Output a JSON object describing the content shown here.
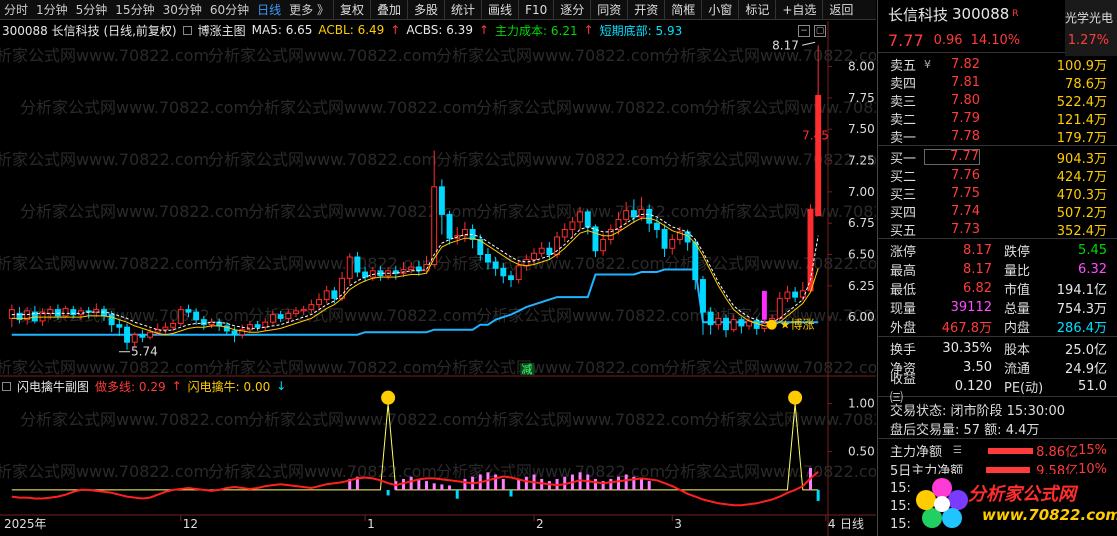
{
  "toolbar": {
    "periods": [
      "分时",
      "1分钟",
      "5分钟",
      "15分钟",
      "30分钟",
      "60分钟",
      "日线",
      "更多 》"
    ],
    "active_period": "日线",
    "buttons": [
      "复权",
      "叠加",
      "多股",
      "统计",
      "画线",
      "F10",
      "逐分",
      "同资",
      "开资",
      "简框",
      "小窗",
      "标记",
      "+自选",
      "返回"
    ]
  },
  "main_legend": {
    "stock": "300088 长信科技 (日线,前复权)",
    "formula": "博涨主图",
    "ma5": "MA5: 6.65",
    "acbl": "ACBL: 6.49",
    "acbs": "ACBS: 6.39",
    "cost": "主力成本: 6.21",
    "bottom": "短期底部: 5.93"
  },
  "sub_legend": {
    "name": "闪电擒牛副图",
    "line1": "做多线: 0.29",
    "line2": "闪电擒牛: 0.00"
  },
  "y_axis_main": [
    "8.00",
    "7.75",
    "7.50",
    "7.25",
    "7.00",
    "6.75",
    "6.50",
    "6.25",
    "6.00"
  ],
  "y_axis_sub": [
    "1.00",
    "0.50"
  ],
  "x_axis": [
    "2025年",
    "12",
    "1",
    "2",
    "3",
    "4"
  ],
  "period_label": "日线",
  "annotations": {
    "high": "8.17",
    "low": "5.74",
    "mid": "7.45",
    "signal": "★博涨",
    "flag": "减"
  },
  "watermark": "分析家公式网www.70822.com",
  "chart_data": {
    "type": "candlestick",
    "ylim": [
      5.65,
      8.22
    ],
    "candles": [
      [
        5.99,
        6.06,
        6.1,
        5.92
      ],
      [
        6.03,
        5.98,
        6.08,
        5.95
      ],
      [
        5.98,
        6.05,
        6.08,
        5.94
      ],
      [
        6.04,
        5.97,
        6.09,
        5.95
      ],
      [
        5.97,
        6.04,
        6.07,
        5.93
      ],
      [
        6.03,
        6.06,
        6.09,
        5.98
      ],
      [
        6.06,
        6.01,
        6.1,
        5.98
      ],
      [
        6.01,
        6.07,
        6.09,
        5.99
      ],
      [
        6.06,
        6.02,
        6.09,
        5.99
      ],
      [
        6.02,
        6.05,
        6.08,
        5.98
      ],
      [
        6.05,
        6.04,
        6.08,
        5.99
      ],
      [
        6.04,
        6.06,
        6.11,
        6.0
      ],
      [
        6.06,
        6.01,
        6.09,
        5.97
      ],
      [
        6.02,
        5.94,
        6.05,
        5.88
      ],
      [
        5.94,
        5.92,
        5.98,
        5.85
      ],
      [
        5.92,
        5.8,
        5.95,
        5.74
      ],
      [
        5.8,
        5.86,
        5.88,
        5.76
      ],
      [
        5.86,
        5.84,
        5.9,
        5.8
      ],
      [
        5.84,
        5.88,
        5.91,
        5.82
      ],
      [
        5.88,
        5.9,
        5.95,
        5.85
      ],
      [
        5.9,
        5.92,
        5.96,
        5.86
      ],
      [
        5.92,
        5.95,
        5.98,
        5.89
      ],
      [
        5.95,
        6.06,
        6.09,
        5.93
      ],
      [
        6.06,
        6.04,
        6.1,
        6.0
      ],
      [
        6.04,
        5.98,
        6.07,
        5.94
      ],
      [
        5.98,
        5.94,
        6.01,
        5.9
      ],
      [
        5.94,
        5.96,
        5.99,
        5.91
      ],
      [
        5.96,
        5.93,
        5.99,
        5.89
      ],
      [
        5.93,
        5.89,
        5.96,
        5.86
      ],
      [
        5.89,
        5.86,
        5.92,
        5.8
      ],
      [
        5.86,
        5.9,
        5.94,
        5.83
      ],
      [
        5.9,
        5.94,
        5.97,
        5.88
      ],
      [
        5.94,
        5.92,
        5.97,
        5.89
      ],
      [
        5.92,
        5.96,
        5.99,
        5.89
      ],
      [
        5.96,
        6.02,
        6.05,
        5.94
      ],
      [
        6.02,
        5.99,
        6.05,
        5.96
      ],
      [
        5.99,
        6.03,
        6.06,
        5.96
      ],
      [
        6.03,
        6.05,
        6.08,
        6.0
      ],
      [
        6.05,
        6.06,
        6.09,
        6.02
      ],
      [
        6.06,
        6.1,
        6.14,
        6.03
      ],
      [
        6.1,
        6.14,
        6.19,
        6.07
      ],
      [
        6.14,
        6.21,
        6.25,
        6.11
      ],
      [
        6.21,
        6.15,
        6.24,
        6.11
      ],
      [
        6.15,
        6.31,
        6.36,
        6.13
      ],
      [
        6.31,
        6.48,
        6.51,
        6.26
      ],
      [
        6.48,
        6.36,
        6.52,
        6.32
      ],
      [
        6.36,
        6.32,
        6.4,
        6.28
      ],
      [
        6.32,
        6.37,
        6.4,
        6.29
      ],
      [
        6.37,
        6.33,
        6.41,
        6.29
      ],
      [
        6.33,
        6.37,
        6.4,
        6.3
      ],
      [
        6.37,
        6.35,
        6.41,
        6.3
      ],
      [
        6.35,
        6.38,
        6.44,
        6.32
      ],
      [
        6.38,
        6.4,
        6.44,
        6.35
      ],
      [
        6.4,
        6.37,
        6.45,
        6.33
      ],
      [
        6.37,
        6.42,
        6.49,
        6.35
      ],
      [
        6.42,
        7.04,
        7.33,
        6.4
      ],
      [
        7.04,
        6.82,
        7.1,
        6.66
      ],
      [
        6.82,
        6.63,
        6.85,
        6.58
      ],
      [
        6.63,
        6.65,
        6.72,
        6.58
      ],
      [
        6.65,
        6.7,
        6.76,
        6.6
      ],
      [
        6.7,
        6.62,
        6.74,
        6.55
      ],
      [
        6.62,
        6.5,
        6.66,
        6.45
      ],
      [
        6.5,
        6.44,
        6.55,
        6.38
      ],
      [
        6.44,
        6.39,
        6.48,
        6.33
      ],
      [
        6.39,
        6.33,
        6.43,
        6.27
      ],
      [
        6.33,
        6.3,
        6.37,
        6.24
      ],
      [
        6.3,
        6.41,
        6.45,
        6.27
      ],
      [
        6.41,
        6.46,
        6.5,
        6.37
      ],
      [
        6.46,
        6.51,
        6.55,
        6.42
      ],
      [
        6.51,
        6.55,
        6.6,
        6.48
      ],
      [
        6.55,
        6.5,
        6.6,
        6.46
      ],
      [
        6.5,
        6.64,
        6.68,
        6.47
      ],
      [
        6.64,
        6.7,
        6.75,
        6.6
      ],
      [
        6.7,
        6.76,
        6.8,
        6.64
      ],
      [
        6.76,
        6.84,
        6.88,
        6.7
      ],
      [
        6.84,
        6.72,
        6.86,
        6.66
      ],
      [
        6.72,
        6.53,
        6.74,
        6.48
      ],
      [
        6.53,
        6.62,
        6.67,
        6.49
      ],
      [
        6.62,
        6.7,
        6.74,
        6.58
      ],
      [
        6.7,
        6.78,
        6.84,
        6.66
      ],
      [
        6.78,
        6.85,
        6.92,
        6.74
      ],
      [
        6.85,
        6.8,
        6.94,
        6.75
      ],
      [
        6.8,
        6.86,
        6.96,
        6.77
      ],
      [
        6.86,
        6.75,
        6.9,
        6.68
      ],
      [
        6.75,
        6.7,
        6.79,
        6.63
      ],
      [
        6.7,
        6.55,
        6.74,
        6.48
      ],
      [
        6.55,
        6.62,
        6.66,
        6.5
      ],
      [
        6.62,
        6.68,
        6.72,
        6.58
      ],
      [
        6.68,
        6.6,
        6.7,
        6.53
      ],
      [
        6.6,
        6.3,
        6.62,
        6.22
      ],
      [
        6.3,
        6.04,
        6.33,
        5.86
      ],
      [
        6.04,
        5.94,
        6.08,
        5.86
      ],
      [
        5.94,
        5.99,
        6.04,
        5.9
      ],
      [
        5.99,
        5.9,
        6.02,
        5.84
      ],
      [
        5.9,
        5.98,
        6.02,
        5.88
      ],
      [
        5.98,
        5.93,
        6.0,
        5.87
      ],
      [
        5.93,
        5.97,
        6.0,
        5.9
      ],
      [
        5.97,
        5.91,
        6.0,
        5.86
      ],
      [
        5.91,
        5.95,
        5.98,
        5.88
      ],
      [
        5.95,
        5.99,
        6.02,
        5.92
      ],
      [
        5.99,
        6.15,
        6.2,
        5.97
      ],
      [
        6.15,
        6.2,
        6.25,
        6.12
      ],
      [
        6.2,
        6.16,
        6.24,
        6.12
      ],
      [
        6.16,
        6.21,
        6.28,
        6.13
      ],
      [
        6.21,
        6.86,
        6.9,
        6.75
      ],
      [
        6.81,
        7.77,
        8.17,
        6.82
      ]
    ],
    "ma_line": [
      6.02,
      6.02,
      6.02,
      6.03,
      6.03,
      6.03,
      6.03,
      6.03,
      6.03,
      6.03,
      6.04,
      6.04,
      6.04,
      6.03,
      6.01,
      5.99,
      5.96,
      5.94,
      5.92,
      5.9,
      5.89,
      5.9,
      5.92,
      5.94,
      5.95,
      5.95,
      5.96,
      5.96,
      5.95,
      5.93,
      5.92,
      5.91,
      5.91,
      5.92,
      5.93,
      5.94,
      5.96,
      5.98,
      6.0,
      6.02,
      6.06,
      6.1,
      6.13,
      6.18,
      6.25,
      6.29,
      6.32,
      6.34,
      6.35,
      6.35,
      6.35,
      6.36,
      6.37,
      6.37,
      6.38,
      6.5,
      6.59,
      6.62,
      6.64,
      6.66,
      6.66,
      6.64,
      6.6,
      6.56,
      6.52,
      6.48,
      6.45,
      6.44,
      6.45,
      6.47,
      6.49,
      6.53,
      6.58,
      6.64,
      6.7,
      6.72,
      6.7,
      6.68,
      6.68,
      6.71,
      6.75,
      6.79,
      6.82,
      6.82,
      6.8,
      6.76,
      6.72,
      6.7,
      6.68,
      6.62,
      6.52,
      6.4,
      6.28,
      6.18,
      6.09,
      6.04,
      6.0,
      5.98,
      5.96,
      5.96,
      5.99,
      6.04,
      6.09,
      6.14,
      6.3,
      6.65
    ],
    "ma_line2": [
      5.99,
      5.99,
      5.99,
      6.0,
      6.0,
      6.0,
      6.0,
      6.0,
      6.0,
      6.0,
      6.01,
      6.01,
      6.01,
      6.0,
      5.98,
      5.96,
      5.93,
      5.91,
      5.89,
      5.87,
      5.86,
      5.87,
      5.89,
      5.91,
      5.92,
      5.92,
      5.93,
      5.93,
      5.92,
      5.9,
      5.89,
      5.88,
      5.88,
      5.89,
      5.9,
      5.91,
      5.93,
      5.95,
      5.97,
      5.99,
      6.03,
      6.07,
      6.1,
      6.15,
      6.22,
      6.26,
      6.29,
      6.31,
      6.32,
      6.32,
      6.32,
      6.33,
      6.34,
      6.34,
      6.35,
      6.47,
      6.56,
      6.59,
      6.61,
      6.63,
      6.63,
      6.61,
      6.57,
      6.53,
      6.49,
      6.45,
      6.42,
      6.41,
      6.42,
      6.44,
      6.46,
      6.5,
      6.55,
      6.61,
      6.67,
      6.69,
      6.67,
      6.65,
      6.65,
      6.68,
      6.72,
      6.76,
      6.79,
      6.79,
      6.77,
      6.73,
      6.69,
      6.67,
      6.65,
      6.59,
      6.49,
      6.37,
      6.25,
      6.15,
      6.06,
      6.01,
      5.97,
      5.95,
      5.93,
      5.93,
      5.96,
      6.01,
      6.06,
      6.11,
      6.2,
      6.39
    ],
    "cost_line": [
      5.86,
      5.86,
      5.86,
      5.86,
      5.86,
      5.86,
      5.86,
      5.86,
      5.86,
      5.86,
      5.86,
      5.86,
      5.86,
      5.86,
      5.86,
      5.86,
      5.86,
      5.86,
      5.86,
      5.86,
      5.86,
      5.86,
      5.86,
      5.86,
      5.86,
      5.86,
      5.86,
      5.86,
      5.86,
      5.86,
      5.86,
      5.86,
      5.86,
      5.86,
      5.86,
      5.86,
      5.86,
      5.86,
      5.86,
      5.86,
      5.86,
      5.86,
      5.86,
      5.86,
      5.86,
      5.86,
      5.88,
      5.88,
      5.88,
      5.88,
      5.88,
      5.88,
      5.88,
      5.88,
      5.88,
      5.9,
      5.9,
      5.9,
      5.9,
      5.9,
      5.9,
      5.94,
      5.94,
      5.98,
      6.0,
      6.02,
      6.05,
      6.08,
      6.1,
      6.12,
      6.14,
      6.16,
      6.16,
      6.16,
      6.16,
      6.16,
      6.34,
      6.34,
      6.34,
      6.34,
      6.34,
      6.34,
      6.36,
      6.36,
      6.36,
      6.38,
      6.38,
      6.38,
      6.38,
      6.38,
      5.96,
      5.96,
      5.96,
      5.96,
      5.96,
      5.96,
      5.96,
      5.96,
      5.96,
      5.96,
      5.96,
      5.96,
      5.96,
      5.96,
      5.96,
      5.96
    ],
    "sub_line": [
      0.03,
      0.02,
      0.02,
      0.01,
      0.01,
      0.02,
      0.03,
      0.05,
      0.08,
      0.1,
      0.1,
      0.09,
      0.08,
      0.07,
      0.05,
      0.03,
      0.02,
      0.01,
      0.02,
      0.05,
      0.08,
      0.1,
      0.11,
      0.12,
      0.11,
      0.1,
      0.09,
      0.1,
      0.12,
      0.13,
      0.12,
      0.11,
      0.12,
      0.14,
      0.15,
      0.16,
      0.15,
      0.14,
      0.13,
      0.12,
      0.14,
      0.16,
      0.17,
      0.18,
      0.2,
      0.22,
      0.23,
      0.22,
      0.2,
      0.17,
      0.15,
      0.17,
      0.19,
      0.21,
      0.22,
      0.22,
      0.21,
      0.2,
      0.19,
      0.18,
      0.17,
      0.18,
      0.2,
      0.22,
      0.24,
      0.23,
      0.21,
      0.19,
      0.18,
      0.17,
      0.16,
      0.15,
      0.16,
      0.18,
      0.2,
      0.19,
      0.18,
      0.17,
      0.18,
      0.19,
      0.2,
      0.21,
      0.22,
      0.21,
      0.2,
      0.17,
      0.14,
      0.1,
      0.06,
      0.03,
      0.0,
      -0.02,
      -0.04,
      -0.05,
      -0.06,
      -0.06,
      -0.05,
      -0.04,
      -0.02,
      0.0,
      0.03,
      0.07,
      0.1,
      0.14,
      0.22,
      0.29
    ],
    "sub_yellow": [
      0.1,
      0.1,
      0.1,
      0.1,
      0.1,
      0.1,
      0.1,
      0.1,
      0.1,
      0.1,
      0.1,
      0.1,
      0.1,
      0.1,
      0.1,
      0.1,
      0.1,
      0.1,
      0.1,
      0.1,
      0.1,
      0.1,
      0.1,
      0.1,
      0.1,
      0.1,
      0.1,
      0.1,
      0.1,
      0.1,
      0.1,
      0.1,
      0.1,
      0.1,
      0.1,
      0.1,
      0.1,
      0.1,
      0.1,
      0.1,
      0.1,
      0.1,
      0.1,
      0.1,
      0.1,
      0.1,
      0.1,
      0.1,
      0.1,
      1.0,
      0.1,
      0.1,
      0.1,
      0.1,
      0.1,
      0.1,
      0.1,
      0.1,
      0.1,
      0.1,
      0.1,
      0.1,
      0.1,
      0.1,
      0.1,
      0.1,
      0.1,
      0.1,
      0.1,
      0.1,
      0.1,
      0.1,
      0.1,
      0.1,
      0.1,
      0.1,
      0.1,
      0.1,
      0.1,
      0.1,
      0.1,
      0.1,
      0.1,
      0.1,
      0.1,
      0.1,
      0.1,
      0.1,
      0.1,
      0.1,
      0.1,
      0.1,
      0.1,
      0.1,
      0.1,
      0.1,
      0.1,
      0.1,
      0.1,
      0.1,
      0.1,
      0.1,
      1.0,
      0.1,
      0.1,
      0.1
    ],
    "sub_bars": [
      0,
      0,
      0,
      0,
      0,
      0,
      0,
      0,
      0,
      0,
      0,
      0,
      0,
      0,
      0,
      0,
      0,
      0,
      0,
      0,
      0,
      0,
      0,
      0,
      0,
      0,
      0,
      0,
      0,
      0,
      0,
      0,
      0,
      0,
      0,
      0,
      0,
      0,
      0,
      0,
      0,
      0,
      0,
      0,
      0.1,
      0.12,
      0,
      0,
      0,
      -0.05,
      0.08,
      0.1,
      0.12,
      0.1,
      0.08,
      0.06,
      0.05,
      0.04,
      -0.08,
      0.1,
      0.12,
      0.14,
      0.16,
      0.14,
      0.1,
      -0.06,
      0.1,
      0.12,
      0.14,
      0.1,
      0.08,
      0.1,
      0.12,
      0.14,
      0.16,
      0.14,
      0.1,
      0.08,
      0.1,
      0.12,
      0.14,
      0.12,
      0.1,
      0.08,
      0,
      0,
      0,
      0,
      0,
      0,
      0,
      0,
      0,
      0,
      0,
      0,
      0,
      0,
      0,
      0,
      0,
      0,
      0,
      0,
      0.2,
      -0.1
    ]
  },
  "quote": {
    "name": "长信科技",
    "code": "300088",
    "badge": "R",
    "sector": "光学光电",
    "price": "7.77",
    "change": "0.96",
    "pct": "14.10%",
    "sector_pct": "1.27%",
    "asks": [
      {
        "label": "卖五",
        "flag": "¥",
        "price": "7.82",
        "vol": "100.9万"
      },
      {
        "label": "卖四",
        "flag": "",
        "price": "7.81",
        "vol": "78.6万"
      },
      {
        "label": "卖三",
        "flag": "",
        "price": "7.80",
        "vol": "522.4万"
      },
      {
        "label": "卖二",
        "flag": "",
        "price": "7.79",
        "vol": "121.4万"
      },
      {
        "label": "卖一",
        "flag": "",
        "price": "7.78",
        "vol": "179.7万"
      }
    ],
    "bids": [
      {
        "label": "买一",
        "price": "7.77",
        "vol": "904.3万"
      },
      {
        "label": "买二",
        "price": "7.76",
        "vol": "424.7万"
      },
      {
        "label": "买三",
        "price": "7.75",
        "vol": "470.3万"
      },
      {
        "label": "买四",
        "price": "7.74",
        "vol": "507.2万"
      },
      {
        "label": "买五",
        "price": "7.73",
        "vol": "352.4万"
      }
    ],
    "stats": [
      {
        "l1": "涨停",
        "v1": "8.17",
        "c1": "red",
        "l2": "跌停",
        "v2": "5.45",
        "c2": "green"
      },
      {
        "l1": "最高",
        "v1": "8.17",
        "c1": "red",
        "l2": "量比",
        "v2": "6.32",
        "c2": "mag"
      },
      {
        "l1": "最低",
        "v1": "6.82",
        "c1": "red",
        "l2": "市值",
        "v2": "194.1亿",
        "c2": "white"
      },
      {
        "l1": "现量",
        "v1": "39112",
        "c1": "mag",
        "l2": "总量",
        "v2": "754.3万",
        "c2": "white"
      },
      {
        "l1": "外盘",
        "v1": "467.8万",
        "c1": "red",
        "l2": "内盘",
        "v2": "286.4万",
        "c2": "cyan"
      }
    ],
    "stats2": [
      {
        "l1": "换手",
        "v1": "30.35%",
        "l2": "股本",
        "v2": "25.0亿"
      },
      {
        "l1": "净资",
        "v1": "3.50",
        "l2": "流通",
        "v2": "24.9亿"
      },
      {
        "l1": "收益㈢",
        "v1": "0.120",
        "l2": "PE(动)",
        "v2": "51.0"
      }
    ],
    "trade_status": "交易状态: 闭市阶段 15:30:00",
    "after_trade": "盘后交易量: 57  额: 4.4万",
    "flows": [
      {
        "label": "主力净额",
        "value": "8.86亿",
        "pct": "15%"
      },
      {
        "label": "5日主力净额",
        "value": "9.58亿",
        "pct": "10%"
      }
    ],
    "times": [
      "15:",
      "15:",
      "15:"
    ],
    "logo_text": "分析家公式网",
    "logo_url": "www.70822.com"
  }
}
